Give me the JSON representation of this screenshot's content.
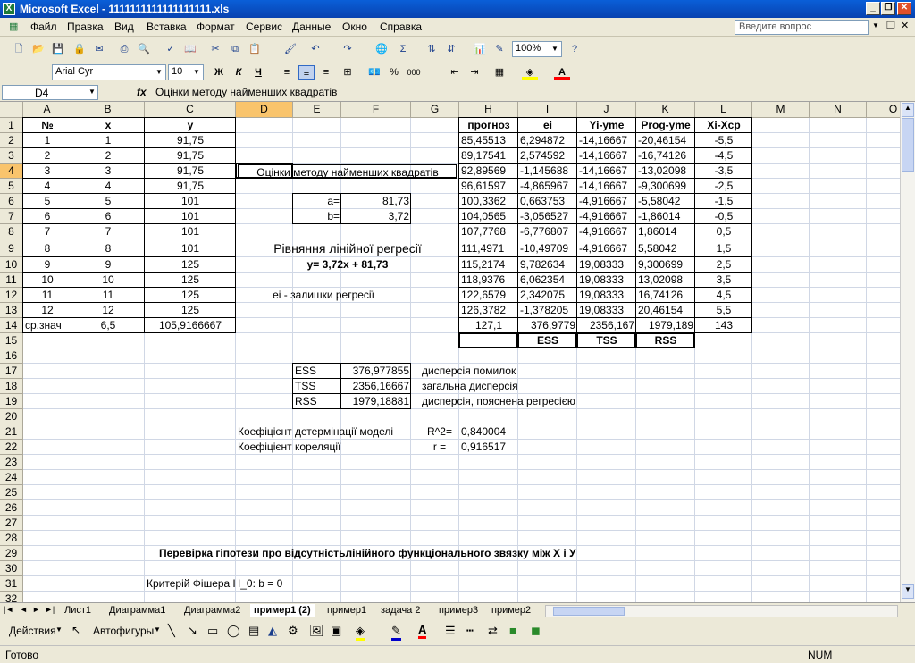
{
  "window": {
    "title": "Microsoft Excel - 1111111111111111111.xls"
  },
  "menu": {
    "items": [
      "Файл",
      "Правка",
      "Вид",
      "Вставка",
      "Формат",
      "Сервис",
      "Данные",
      "Окно",
      "Справка"
    ],
    "help_placeholder": "Введите вопрос"
  },
  "toolbar": {
    "zoom": "100%",
    "font": "Arial Cyr",
    "size": "10",
    "bold": "Ж",
    "italic": "К",
    "underline": "Ч",
    "percent": "%",
    "thousands": "000"
  },
  "formula_bar": {
    "name_box": "D4",
    "fx": "fx",
    "content": "Оцінки методу найменших квадратів"
  },
  "columns": [
    "A",
    "B",
    "C",
    "D",
    "E",
    "F",
    "G",
    "H",
    "I",
    "J",
    "K",
    "L",
    "M",
    "N",
    "O"
  ],
  "rows": [
    "1",
    "2",
    "3",
    "4",
    "5",
    "6",
    "7",
    "8",
    "9",
    "10",
    "11",
    "12",
    "13",
    "14",
    "15",
    "16",
    "17",
    "18",
    "19",
    "20",
    "21",
    "22",
    "23",
    "24",
    "25",
    "26",
    "27",
    "28",
    "29",
    "30",
    "31",
    "32"
  ],
  "table_left": {
    "headers": [
      "№",
      "x",
      "y"
    ],
    "rows": [
      [
        "1",
        "1",
        "91,75"
      ],
      [
        "2",
        "2",
        "91,75"
      ],
      [
        "3",
        "3",
        "91,75"
      ],
      [
        "4",
        "4",
        "91,75"
      ],
      [
        "5",
        "5",
        "101"
      ],
      [
        "6",
        "6",
        "101"
      ],
      [
        "7",
        "7",
        "101"
      ],
      [
        "8",
        "8",
        "101"
      ],
      [
        "9",
        "9",
        "125"
      ],
      [
        "10",
        "10",
        "125"
      ],
      [
        "11",
        "11",
        "125"
      ],
      [
        "12",
        "12",
        "125"
      ]
    ],
    "mean_label": "ср.знач",
    "mean_x": "6,5",
    "mean_y": "105,9166667"
  },
  "table_right": {
    "headers": [
      "прогноз",
      "ei",
      "Yi-yme",
      "Prog-yme",
      "Xi-Xcp"
    ],
    "rows": [
      [
        "85,45513",
        "6,294872",
        "-14,16667",
        "-20,46154",
        "-5,5"
      ],
      [
        "89,17541",
        "2,574592",
        "-14,16667",
        "-16,74126",
        "-4,5"
      ],
      [
        "92,89569",
        "-1,145688",
        "-14,16667",
        "-13,02098",
        "-3,5"
      ],
      [
        "96,61597",
        "-4,865967",
        "-14,16667",
        "-9,300699",
        "-2,5"
      ],
      [
        "100,3362",
        "0,663753",
        "-4,916667",
        "-5,58042",
        "-1,5"
      ],
      [
        "104,0565",
        "-3,056527",
        "-4,916667",
        "-1,86014",
        "-0,5"
      ],
      [
        "107,7768",
        "-6,776807",
        "-4,916667",
        "1,86014",
        "0,5"
      ],
      [
        "111,4971",
        "-10,49709",
        "-4,916667",
        "5,58042",
        "1,5"
      ],
      [
        "115,2174",
        "9,782634",
        "19,08333",
        "9,300699",
        "2,5"
      ],
      [
        "118,9376",
        "6,062354",
        "19,08333",
        "13,02098",
        "3,5"
      ],
      [
        "122,6579",
        "2,342075",
        "19,08333",
        "16,74126",
        "4,5"
      ],
      [
        "126,3782",
        "-1,378205",
        "19,08333",
        "20,46154",
        "5,5"
      ]
    ],
    "totals": [
      "127,1",
      "376,9779",
      "2356,167",
      "1979,189",
      "143"
    ],
    "labels": [
      "ESS",
      "TSS",
      "RSS"
    ]
  },
  "middle": {
    "ols_title": "Оцінки методу найменших квадратів",
    "a_label": "a=",
    "a_value": "81,73",
    "b_label": "b=",
    "b_value": "3,72",
    "regression_title": "Рівняння лінійної регресії",
    "equation": "y= 3,72x + 81,73",
    "residuals_note": "ei - залишки регресії"
  },
  "variance": {
    "rows": [
      {
        "label": "ESS",
        "value": "376,977855",
        "desc": "дисперсія помилок"
      },
      {
        "label": "TSS",
        "value": "2356,16667",
        "desc": "загальна дисперсія"
      },
      {
        "label": "RSS",
        "value": "1979,18881",
        "desc": "дисперсія, пояснена регресією"
      }
    ]
  },
  "coefficients": {
    "determination_label": "Коефіцієнт детермінації моделі",
    "determination_sym": "R^2=",
    "determination_value": "0,840004",
    "correlation_label": "Коефіцієнт кореляції",
    "correlation_sym": "r =",
    "correlation_value": "0,916517"
  },
  "hypothesis": {
    "title": "Перевірка гіпотези про відсутністьлінійного функціонального звязку між X і У",
    "fisher": "Критерій Фішера H_0: b = 0"
  },
  "sheet_tabs": [
    "Лист1",
    "Диаграмма1",
    "Диаграмма2",
    "пример1 (2)",
    "пример1",
    "задача 2",
    "пример3",
    "пример2"
  ],
  "drawing": {
    "actions": "Действия",
    "autoshapes": "Автофигуры"
  },
  "status": {
    "ready": "Готово",
    "num": "NUM"
  }
}
